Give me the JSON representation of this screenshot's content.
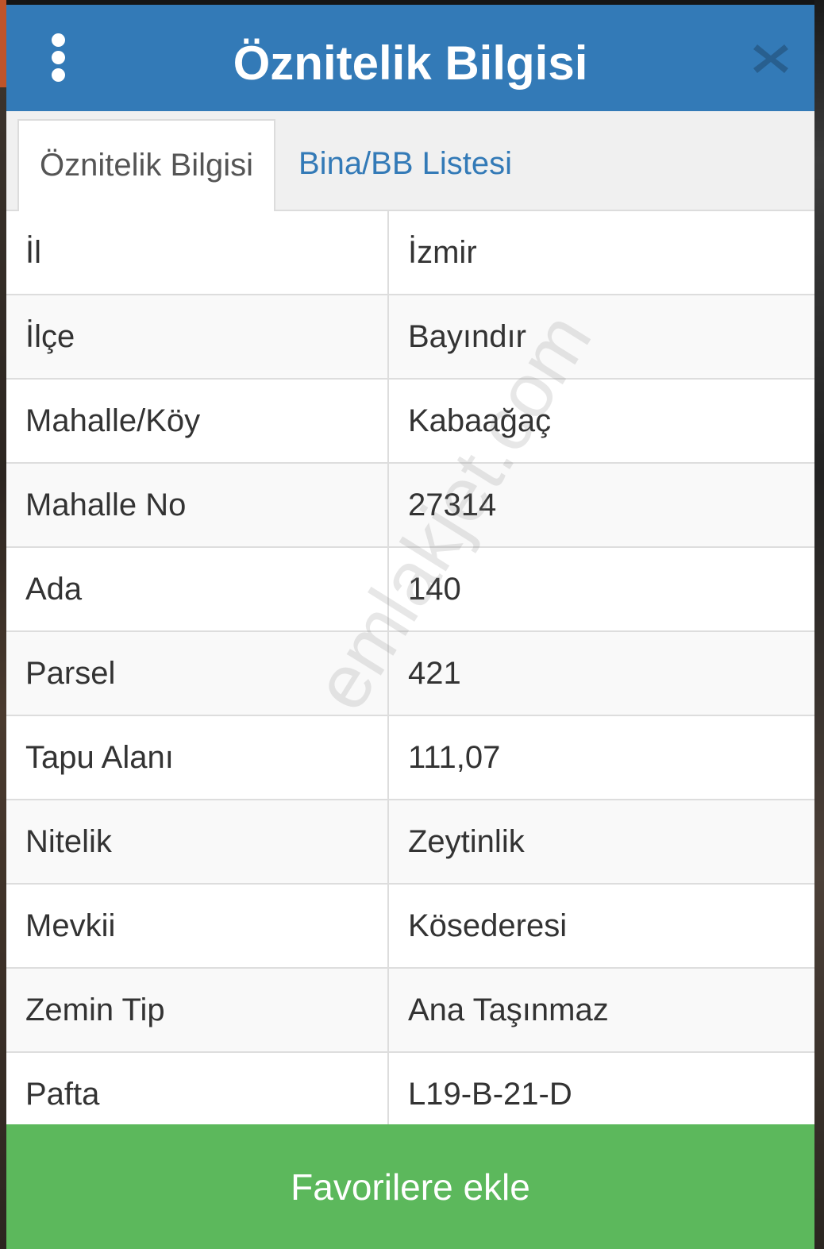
{
  "dialog": {
    "title": "Öznitelik Bilgisi",
    "menu_icon": "vertical-dots-icon",
    "close_icon": "close-x-icon"
  },
  "tabs": [
    {
      "label": "Öznitelik Bilgisi",
      "active": true
    },
    {
      "label": "Bina/BB Listesi",
      "active": false
    }
  ],
  "attributes": [
    {
      "label": "İl",
      "value": "İzmir"
    },
    {
      "label": "İlçe",
      "value": "Bayındır"
    },
    {
      "label": "Mahalle/Köy",
      "value": "Kabaağaç"
    },
    {
      "label": "Mahalle No",
      "value": "27314"
    },
    {
      "label": "Ada",
      "value": "140"
    },
    {
      "label": "Parsel",
      "value": "421"
    },
    {
      "label": "Tapu Alanı",
      "value": "111,07"
    },
    {
      "label": "Nitelik",
      "value": "Zeytinlik"
    },
    {
      "label": "Mevkii",
      "value": "Kösederesi"
    },
    {
      "label": "Zemin Tip",
      "value": "Ana Taşınmaz"
    },
    {
      "label": "Pafta",
      "value": "L19-B-21-D"
    }
  ],
  "watermark": "emlakjet.com",
  "actions": {
    "favorite_label": "Favorilere ekle"
  },
  "colors": {
    "header": "#337ab7",
    "tab_link": "#337ab7",
    "favorite_button": "#5cb85c"
  }
}
